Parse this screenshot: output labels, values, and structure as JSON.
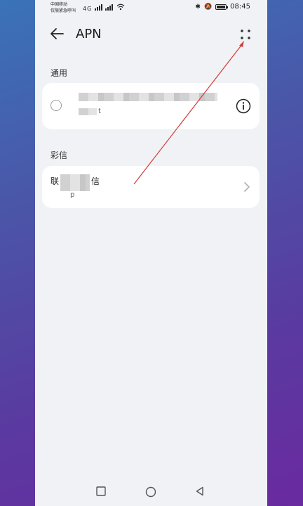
{
  "status_bar": {
    "carrier_line1": "中国移动",
    "carrier_line2": "仅限紧急呼叫",
    "signal_text": "4G",
    "time": "08:45"
  },
  "header": {
    "title": "APN"
  },
  "sections": {
    "general": {
      "label": "通用"
    },
    "mms": {
      "label": "彩信"
    }
  },
  "general_apn": {
    "name": "",
    "sub": "t"
  },
  "mms_apn": {
    "name_start": "联",
    "name_end": "信",
    "sub": "p"
  },
  "colors": {
    "background": "#f1f2f5",
    "card": "#ffffff",
    "annotation_arrow": "#d23a3a"
  },
  "icons": {
    "back": "arrow-left-icon",
    "more": "four-dots-icon",
    "info": "info-circle-icon",
    "chevron": "chevron-right-icon",
    "nav_recent": "square-icon",
    "nav_home": "circle-icon",
    "nav_back": "triangle-back-icon"
  }
}
